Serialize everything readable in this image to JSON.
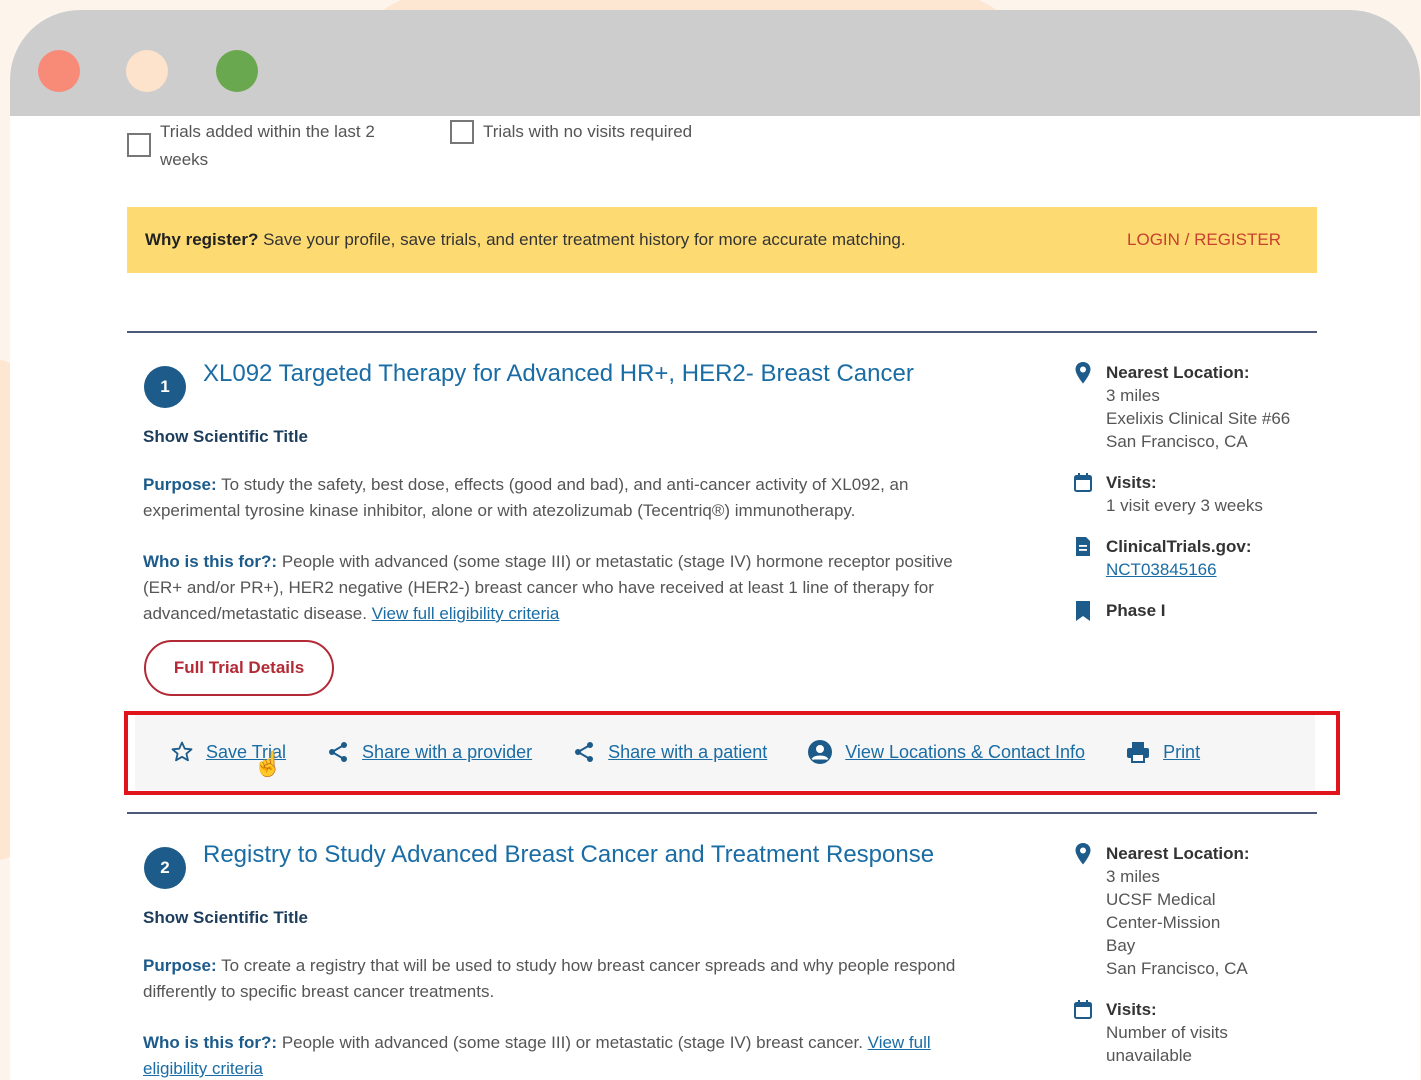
{
  "filters": [
    {
      "label": "Trials added within the last 2 weeks",
      "checked": false
    },
    {
      "label": "Trials with no visits required",
      "checked": false
    }
  ],
  "banner": {
    "bold": "Why register?",
    "text": " Save your profile, save trials, and enter treatment history for more accurate matching.",
    "login": "LOGIN / REGISTER"
  },
  "trials": [
    {
      "number": "1",
      "title": "XL092 Targeted Therapy for Advanced HR+, HER2- Breast Cancer",
      "show_sci": "Show Scientific Title",
      "purpose_label": "Purpose:",
      "purpose": " To study the safety, best dose, effects (good and bad), and anti-cancer activity of XL092, an experimental tyrosine kinase inhibitor, alone or with atezolizumab (Tecentriq®) immunotherapy.",
      "who_label": "Who is this for?:",
      "who": " People with advanced (some stage III) or metastatic (stage IV) hormone receptor positive (ER+ and/or PR+), HER2 negative (HER2-) breast cancer who have received at least 1 line of therapy for advanced/metastatic disease. ",
      "elig_link": "View full eligibility criteria",
      "details_button": "Full Trial Details",
      "nearest_label": "Nearest Location:",
      "distance": "3 miles",
      "site": "Exelixis Clinical Site #66",
      "city": "San Francisco, CA",
      "visits_label": "Visits:",
      "visits": "1 visit every 3 weeks",
      "ct_label": "ClinicalTrials.gov:",
      "ct_id": "NCT03845166",
      "phase": "Phase I"
    },
    {
      "number": "2",
      "title": "Registry to Study Advanced Breast Cancer and Treatment Response",
      "show_sci": "Show Scientific Title",
      "purpose_label": "Purpose:",
      "purpose": " To create a registry that will be used to study how breast cancer spreads and why people respond differently to specific breast cancer treatments.",
      "who_label": "Who is this for?:",
      "who": " People with advanced (some stage III) or metastatic (stage IV) breast cancer. ",
      "elig_link": "View full eligibility criteria",
      "nearest_label": "Nearest Location:",
      "distance": "3 miles",
      "site": "UCSF Medical Center-Mission Bay",
      "city": "San Francisco, CA",
      "visits_label": "Visits:",
      "visits": "Number of visits unavailable"
    }
  ],
  "actions": {
    "save": "Save Trial",
    "share_provider": "Share with a provider",
    "share_patient": "Share with a patient",
    "locations": "View Locations & Contact Info",
    "print": "Print"
  },
  "colors": {
    "accent_blue": "#1a6ca4",
    "number_badge": "#1d5b8a",
    "banner_yellow": "#fddb72",
    "login_red": "#c8402f",
    "details_red": "#b22a36",
    "highlight_red": "#e0151c"
  },
  "icons": {
    "filters": "checkbox-icon",
    "location": "map-pin-icon",
    "visits": "calendar-icon",
    "clinicaltrials": "document-icon",
    "phase": "bookmark-icon",
    "save": "star-icon",
    "share": "share-icon",
    "locations": "user-circle-icon",
    "print": "printer-icon"
  }
}
